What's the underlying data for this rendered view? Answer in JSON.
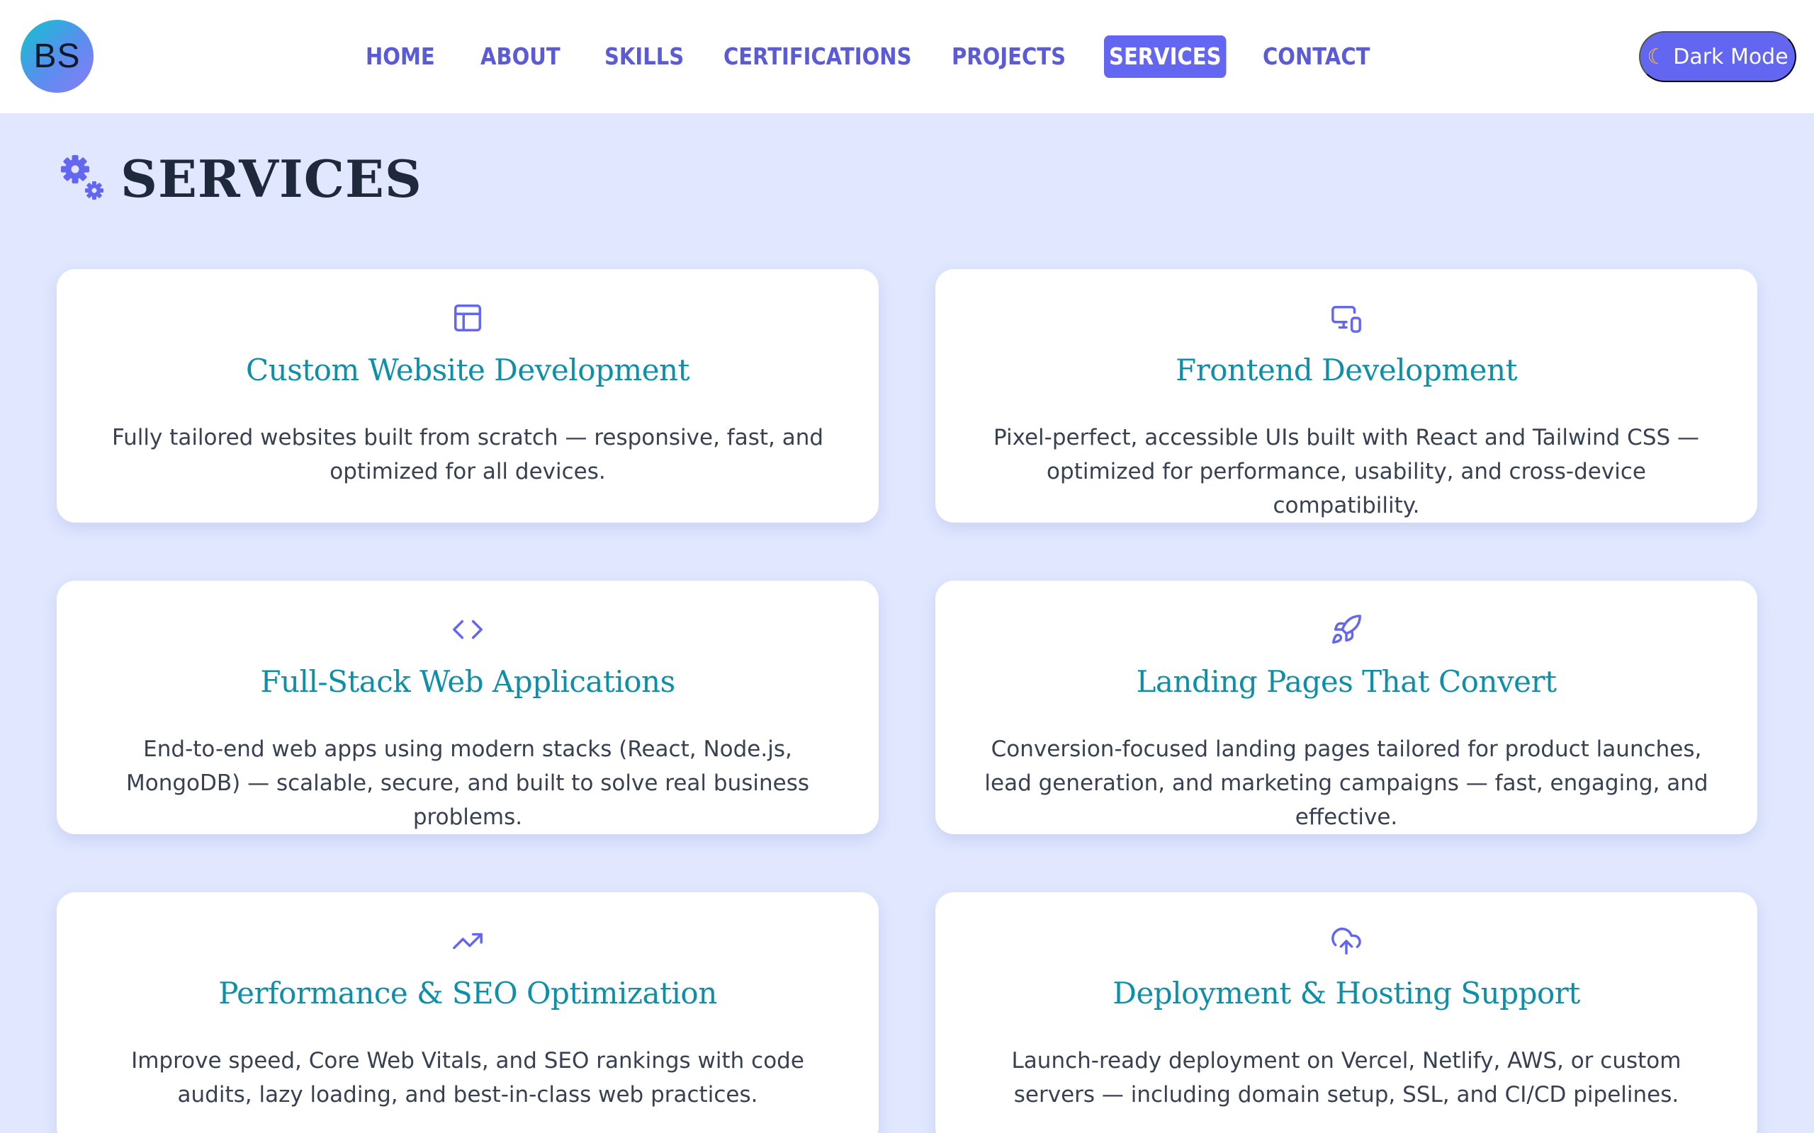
{
  "header": {
    "logo_text": "BS",
    "nav": [
      {
        "label": "HOME"
      },
      {
        "label": "ABOUT"
      },
      {
        "label": "SKILLS"
      },
      {
        "label": "CERTIFICATIONS"
      },
      {
        "label": "PROJECTS"
      },
      {
        "label": "SERVICES",
        "active": true
      },
      {
        "label": "CONTACT"
      }
    ],
    "dark_mode_label": "Dark Mode",
    "dark_mode_icon": "moon-icon"
  },
  "section": {
    "title": "SERVICES",
    "icon": "gears-icon"
  },
  "colors": {
    "accent": "#6366f1",
    "page_background": "#e0e7ff",
    "card_title": "#0e8fa8",
    "heading": "#1e293b"
  },
  "services": [
    {
      "icon": "layout-icon",
      "title": "Custom Website Development",
      "description": "Fully tailored websites built from scratch — responsive, fast, and optimized for all devices."
    },
    {
      "icon": "devices-icon",
      "title": "Frontend Development",
      "description": "Pixel-perfect, accessible UIs built with React and Tailwind CSS — optimized for performance, usability, and cross-device compatibility."
    },
    {
      "icon": "code-icon",
      "title": "Full-Stack Web Applications",
      "description": "End-to-end web apps using modern stacks (React, Node.js, MongoDB) — scalable, secure, and built to solve real business problems."
    },
    {
      "icon": "rocket-icon",
      "title": "Landing Pages That Convert",
      "description": "Conversion-focused landing pages tailored for product launches, lead generation, and marketing campaigns — fast, engaging, and effective."
    },
    {
      "icon": "trending-up-icon",
      "title": "Performance & SEO Optimization",
      "description": "Improve speed, Core Web Vitals, and SEO rankings with code audits, lazy loading, and best-in-class web practices."
    },
    {
      "icon": "cloud-upload-icon",
      "title": "Deployment & Hosting Support",
      "description": "Launch-ready deployment on Vercel, Netlify, AWS, or custom servers — including domain setup, SSL, and CI/CD pipelines."
    }
  ]
}
